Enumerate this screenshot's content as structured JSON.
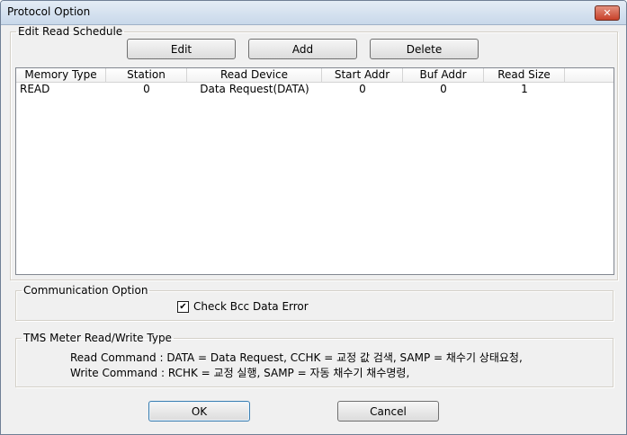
{
  "window": {
    "title": "Protocol Option",
    "close_glyph": "✕"
  },
  "edit_schedule": {
    "legend": "Edit Read Schedule",
    "edit_label": "Edit",
    "add_label": "Add",
    "delete_label": "Delete",
    "columns": [
      "Memory Type",
      "Station",
      "Read Device",
      "Start Addr",
      "Buf Addr",
      "Read Size"
    ],
    "rows": [
      [
        "READ",
        "0",
        "Data Request(DATA)",
        "0",
        "0",
        "1"
      ]
    ]
  },
  "communication": {
    "legend": "Communication Option",
    "check_bcc": {
      "label": "Check Bcc Data Error",
      "checked": true,
      "glyph": "✔"
    }
  },
  "tms": {
    "legend": "TMS Meter Read/Write Type",
    "read_line": "Read Command : DATA = Data Request, CCHK = 교정 값 검색, SAMP = 채수기 상태요청,",
    "write_line": "Write Command : RCHK = 교정 실행, SAMP = 자동 채수기 채수명령,"
  },
  "footer": {
    "ok_label": "OK",
    "cancel_label": "Cancel"
  }
}
